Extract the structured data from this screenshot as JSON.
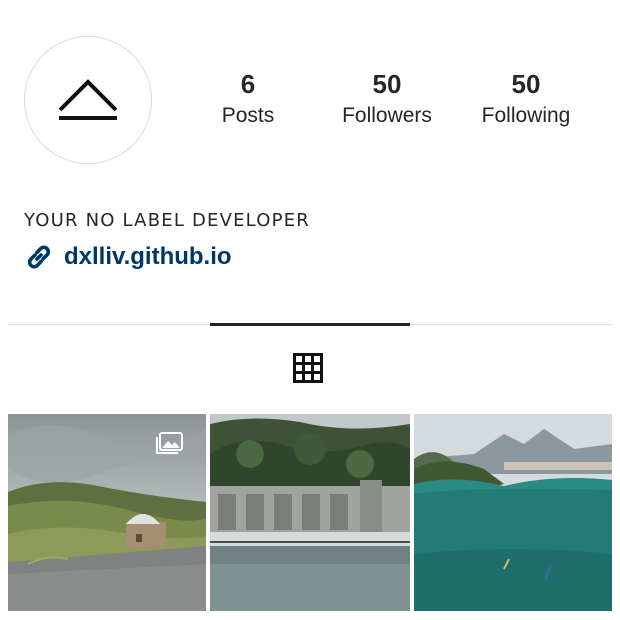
{
  "profile": {
    "bio_name": "YOUR NO LABEL DEVELOPER",
    "website": "dxlliv.github.io",
    "avatar_icon": "collapse-chevron-underline-icon"
  },
  "stats": {
    "posts": {
      "value": "6",
      "label": "Posts"
    },
    "followers": {
      "value": "50",
      "label": "Followers"
    },
    "following": {
      "value": "50",
      "label": "Following"
    }
  },
  "tabs": [
    {
      "icon": "grid-icon",
      "active": true
    }
  ],
  "posts": [
    {
      "thumb": "hilltop-observatory-under-clouds",
      "multi": true
    },
    {
      "thumb": "river-dam-with-forested-hill",
      "multi": false
    },
    {
      "thumb": "lake-with-kayakers-and-mountains",
      "multi": false
    }
  ],
  "colors": {
    "text": "#262626",
    "link": "#00376b",
    "border": "#dbdbdb"
  }
}
